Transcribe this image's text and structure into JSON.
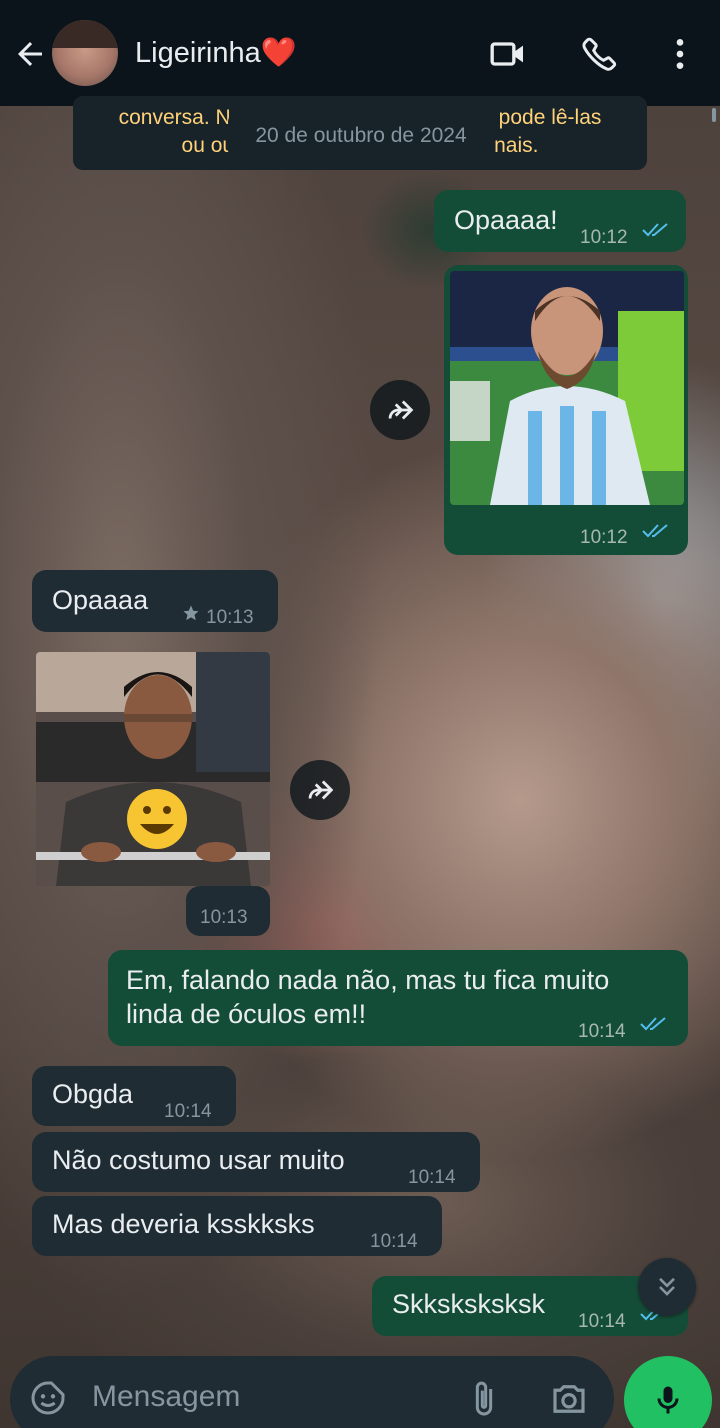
{
  "header": {
    "contact_name": "Ligeirinha",
    "contact_emoji": "❤️"
  },
  "notice": {
    "line1_left": "conversa. N",
    "line1_right": "pode lê-las",
    "line2_left": "ou ou",
    "line2_right": "nais.",
    "date": "20 de outubro de 2024"
  },
  "messages": [
    {
      "dir": "out",
      "text": "Opaaaa!",
      "time": "10:12"
    },
    {
      "dir": "out",
      "type": "image",
      "time": "10:12"
    },
    {
      "dir": "in",
      "text": "Opaaaa",
      "time": "10:13",
      "starred": true
    },
    {
      "dir": "in",
      "type": "image",
      "time": "10:13"
    },
    {
      "dir": "out",
      "text_line1": "Em, falando nada não, mas tu fica muito",
      "text_line2": "linda de óculos em!!",
      "time": "10:14"
    },
    {
      "dir": "in",
      "text": "Obgda",
      "time": "10:14"
    },
    {
      "dir": "in",
      "text": "Não costumo usar muito",
      "time": "10:14"
    },
    {
      "dir": "in",
      "text": "Mas deveria ksskksks",
      "time": "10:14"
    },
    {
      "dir": "out",
      "text": "Skksksksksk",
      "time": "10:14"
    }
  ],
  "composer": {
    "placeholder": "Mensagem"
  },
  "colors": {
    "topbar": "#0b141a",
    "outgoing_bubble": "#144d37",
    "incoming_bubble": "#1f2c34",
    "read_ticks": "#53bdeb",
    "mic_button": "#21c063",
    "notice_text": "#ffd279"
  }
}
